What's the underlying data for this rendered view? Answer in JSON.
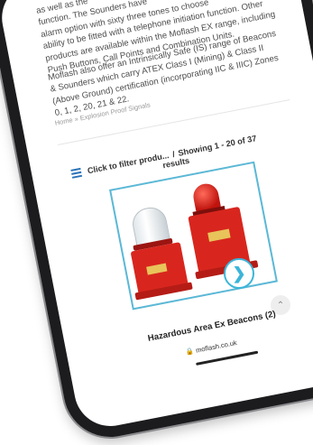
{
  "content": {
    "para1_lines": [
      "as well as the",
      "function. The Sounders have",
      "alarm option with sixty three tones to choose",
      "ability to be fitted with a telephone initiation function. Other",
      "products are available within the Moflash EX range, including",
      "Push Buttons, Call Points and Combination Units."
    ],
    "para2_lines": [
      "Moflash also offer an Intrinsically Safe (IS) range of Beacons",
      "& Sounders which carry ATEX Class I (Mining) & Class II",
      "(Above Ground) certification (incorporating IIC & IIIC) Zones",
      "0, 1, 2, 20, 21 & 22."
    ]
  },
  "breadcrumb": {
    "home": "Home",
    "separator": "»",
    "current": "Explosion Proof Signals"
  },
  "filter": {
    "label": "Click to filter produ...",
    "separator": "/",
    "results_line1": "Showing 1 - 20 of 37",
    "results_line2": "results"
  },
  "product": {
    "category_title": "Hazardous Area Ex Beacons (2)"
  },
  "browser": {
    "url": "moflash.co.uk",
    "lock_icon": "lock-icon"
  },
  "colors": {
    "accent_blue": "#3cb5d9",
    "menu_blue": "#2a73b8",
    "beacon_red": "#d8261e"
  }
}
